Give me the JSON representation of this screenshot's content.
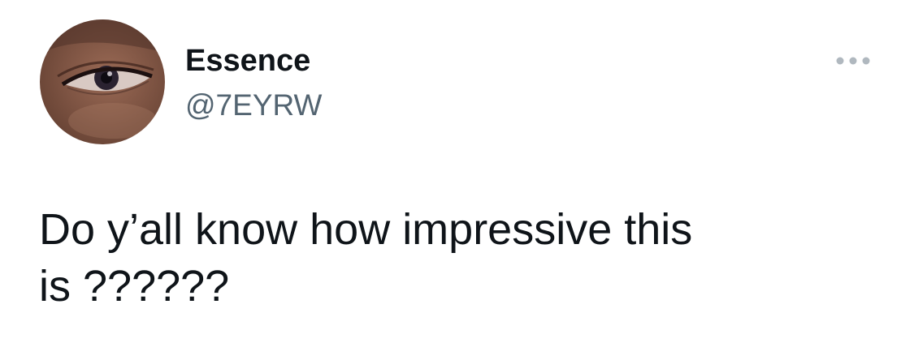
{
  "author": {
    "display_name": "Essence",
    "handle": "@7EYRW",
    "avatar_icon": "user-avatar-eye-closeup"
  },
  "tweet": {
    "text": "Do y’all know how impressive this\nis ??????"
  },
  "more_icon": "more-horizontal-icon",
  "colors": {
    "name": "#0f1419",
    "handle": "#536471",
    "more_icon": "#b0b8bf",
    "background": "#ffffff"
  }
}
